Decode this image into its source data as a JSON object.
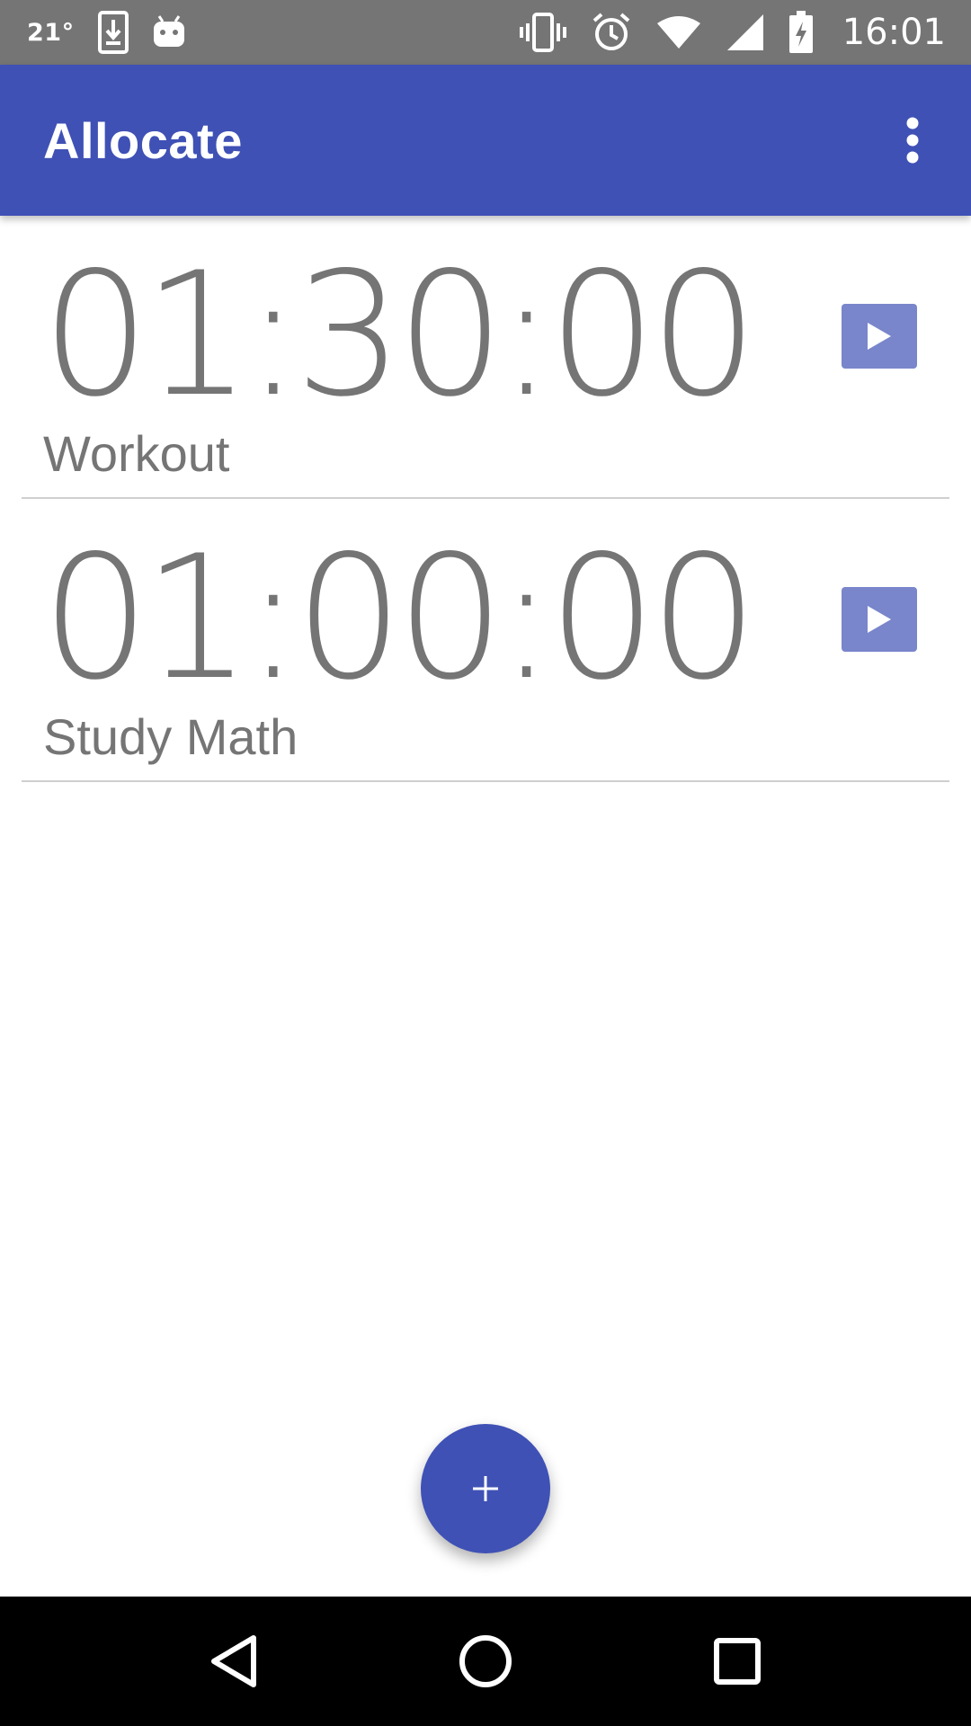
{
  "status_bar": {
    "temperature": "21°",
    "time": "16:01",
    "icons": [
      "download-icon",
      "android-icon",
      "vibrate-icon",
      "alarm-icon",
      "wifi-icon",
      "cell-signal-icon",
      "battery-charging-icon"
    ]
  },
  "app_bar": {
    "title": "Allocate",
    "menu_icon": "more-vert-icon"
  },
  "timers": [
    {
      "time": "01:30:00",
      "name": "Workout",
      "action_icon": "play-icon"
    },
    {
      "time": "01:00:00",
      "name": "Study Math",
      "action_icon": "play-icon"
    }
  ],
  "fab": {
    "icon": "plus-icon",
    "label": "+"
  },
  "nav_bar": {
    "icons": [
      "back-icon",
      "home-icon",
      "recents-icon"
    ]
  },
  "colors": {
    "primary": "#3f51b5",
    "primary_light": "#7986cb",
    "status_bar": "#757575",
    "text_secondary": "#757575"
  }
}
